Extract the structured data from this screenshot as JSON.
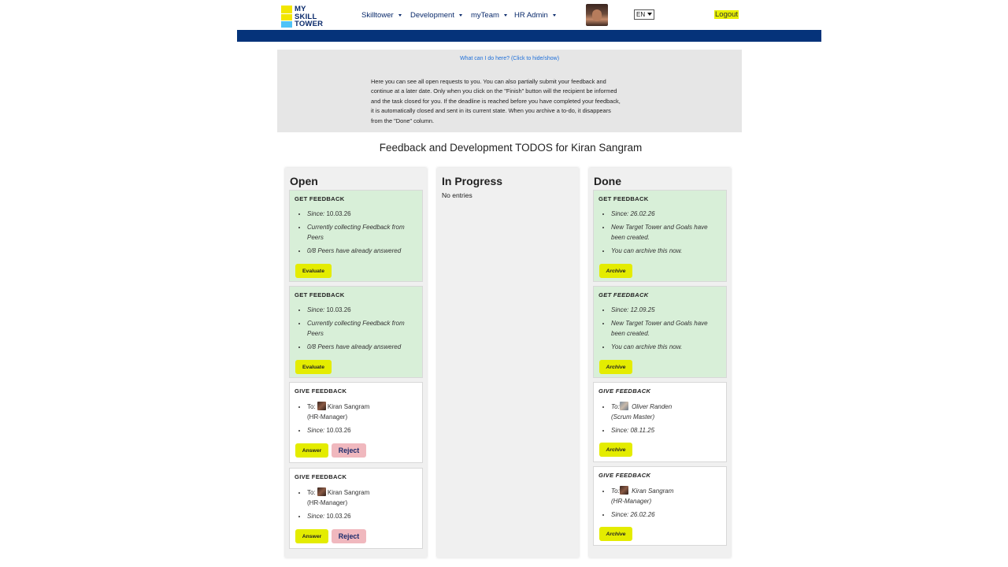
{
  "header": {
    "logo_lines": [
      "MY",
      "SKILL",
      "TOWER"
    ],
    "nav": [
      "Skilltower",
      "Development",
      "myTeam",
      "HR Admin"
    ],
    "language": "EN",
    "logout": "Logout"
  },
  "help": {
    "toggle_link": "What can I do here? (Click to hide/show)",
    "lines": [
      "Here you can see all open requests to you. You can also partially submit your feedback and",
      "continue at a later date. Only when you click on the \"Finish\" button will the recipient be informed",
      "and the task closed for you. If the deadline is reached before you have completed your feedback,",
      "it is automatically closed and sent in its current state. When you archive a to-do, it disappears",
      "from the \"Done\" column."
    ]
  },
  "page_title": "Feedback and Development TODOS for Kiran Sangram",
  "columns": {
    "open": {
      "title": "Open",
      "cards": [
        {
          "title": "GET FEEDBACK",
          "since_label": "Since:",
          "since": "10.03.26",
          "line2": "Currently collecting Feedback from Peers",
          "line3": "0/8 Peers have already answered",
          "button": "Evaluate"
        },
        {
          "title": "GET FEEDBACK",
          "since_label": "Since:",
          "since": "10.03.26",
          "line2": "Currently collecting Feedback from Peers",
          "line3": "0/8 Peers have already answered",
          "button": "Evaluate"
        },
        {
          "title": "GIVE FEEDBACK",
          "to_label": "To:",
          "to_name": "Kiran Sangram",
          "to_role": "(HR-Manager)",
          "since_label": "Since:",
          "since": "10.03.26",
          "button": "Answer",
          "button2": "Reject"
        },
        {
          "title": "GIVE FEEDBACK",
          "to_label": "To:",
          "to_name": "Kiran Sangram",
          "to_role": "(HR-Manager)",
          "since_label": "Since:",
          "since": "10.03.26",
          "button": "Answer",
          "button2": "Reject"
        }
      ]
    },
    "in_progress": {
      "title": "In Progress",
      "empty": "No entries"
    },
    "done": {
      "title": "Done",
      "cards": [
        {
          "title": "GET FEEDBACK",
          "since_label": "Since:",
          "since": "26.02.26",
          "line2": "New Target Tower and Goals have been created.",
          "line3": "You can archive this now.",
          "button": "Archive"
        },
        {
          "title": "GET FEEDBACK",
          "since_label": "Since:",
          "since": "12.09.25",
          "line2": "New Target Tower and Goals have been created.",
          "line3": "You can archive this now.",
          "button": "Archive"
        },
        {
          "title": "GIVE FEEDBACK",
          "to_label": "To:",
          "to_name": "Oliver Randen",
          "to_role": "(Scrum Master)",
          "since_label": "Since:",
          "since": "08.11.25",
          "button": "Archive"
        },
        {
          "title": "GIVE FEEDBACK",
          "to_label": "To:",
          "to_name": "Kiran Sangram",
          "to_role": "(HR-Manager)",
          "since_label": "Since:",
          "since": "26.02.26",
          "button": "Archive"
        }
      ]
    }
  },
  "colors": {
    "navy": "#05337a",
    "lime_button": "#e4ec00",
    "reject_button": "#f0b8be",
    "card_green": "#d8efd8",
    "help_bg": "#e6e6e6",
    "link_blue": "#1e6fd9"
  }
}
